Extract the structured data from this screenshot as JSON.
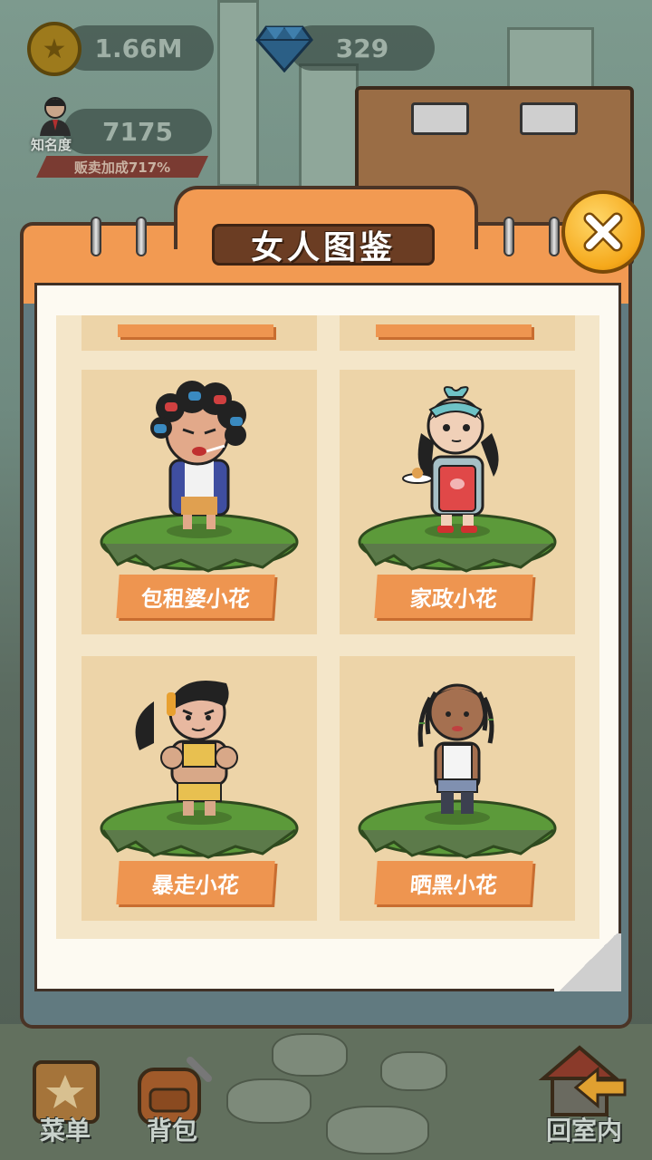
{
  "hud": {
    "coins": "1.66M",
    "gems": "329",
    "fame_value": "7175",
    "fame_label": "知名度",
    "sales_bonus": "贩卖加成717%"
  },
  "modal": {
    "title": "女人图鉴",
    "close_icon": "close-icon"
  },
  "cards": [
    {
      "label": "包租婆小花",
      "character": "landlady-with-curlers"
    },
    {
      "label": "家政小花",
      "character": "housekeeper-with-apron"
    },
    {
      "label": "暴走小花",
      "character": "muscular-woman"
    },
    {
      "label": "晒黑小花",
      "character": "tanned-woman-with-dreadlocks"
    }
  ],
  "bottom_menu": {
    "menu_label": "菜单",
    "bag_label": "背包",
    "return_label": "回室内"
  },
  "colors": {
    "header_orange": "#f29a52",
    "label_orange": "#ee9550",
    "card_bg": "#edd4a8",
    "close_gold": "#f5a81a"
  }
}
